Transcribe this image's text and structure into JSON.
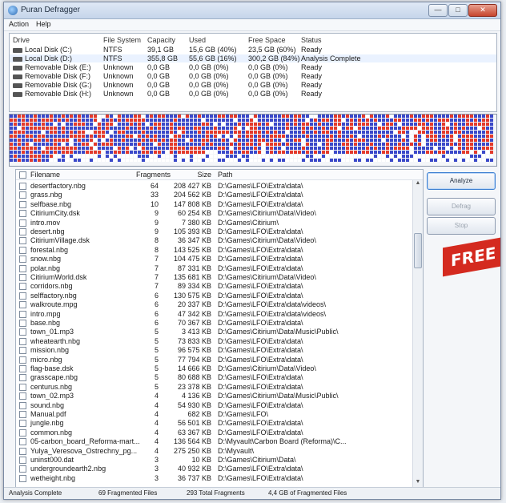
{
  "window": {
    "title": "Puran Defragger"
  },
  "menu": [
    "Action",
    "Help"
  ],
  "drives": {
    "columns": [
      "Drive",
      "File System",
      "Capacity",
      "Used",
      "Free Space",
      "Status"
    ],
    "rows": [
      {
        "drive": "Local Disk (C:)",
        "fs": "NTFS",
        "capacity": "39,1 GB",
        "used": "15,6 GB (40%)",
        "free": "23,5 GB (60%)",
        "status": "Ready"
      },
      {
        "drive": "Local Disk (D:)",
        "fs": "NTFS",
        "capacity": "355,8 GB",
        "used": "55,6 GB (16%)",
        "free": "300,2 GB (84%)",
        "status": "Analysis Complete"
      },
      {
        "drive": "Removable Disk (E:)",
        "fs": "Unknown",
        "capacity": "0,0 GB",
        "used": "0,0 GB (0%)",
        "free": "0,0 GB (0%)",
        "status": "Ready"
      },
      {
        "drive": "Removable Disk (F:)",
        "fs": "Unknown",
        "capacity": "0,0 GB",
        "used": "0,0 GB (0%)",
        "free": "0,0 GB (0%)",
        "status": "Ready"
      },
      {
        "drive": "Removable Disk (G:)",
        "fs": "Unknown",
        "capacity": "0,0 GB",
        "used": "0,0 GB (0%)",
        "free": "0,0 GB (0%)",
        "status": "Ready"
      },
      {
        "drive": "Removable Disk (H:)",
        "fs": "Unknown",
        "capacity": "0,0 GB",
        "used": "0,0 GB (0%)",
        "free": "0,0 GB (0%)",
        "status": "Ready"
      }
    ]
  },
  "files": {
    "columns": [
      "Filename",
      "Fragments",
      "Size",
      "Path"
    ],
    "rows": [
      {
        "name": "desertfactory.nbg",
        "frags": "64",
        "size": "208 427 KB",
        "path": "D:\\Games\\LFO\\Extra\\data\\"
      },
      {
        "name": "grass.nbg",
        "frags": "33",
        "size": "204 562 KB",
        "path": "D:\\Games\\LFO\\Extra\\data\\"
      },
      {
        "name": "selfbase.nbg",
        "frags": "10",
        "size": "147 808 KB",
        "path": "D:\\Games\\LFO\\Extra\\data\\"
      },
      {
        "name": "CitiriumCity.dsk",
        "frags": "9",
        "size": "60 254 KB",
        "path": "D:\\Games\\Citirium\\Data\\Video\\"
      },
      {
        "name": "intro.mov",
        "frags": "9",
        "size": "7 380 KB",
        "path": "D:\\Games\\Citirium\\"
      },
      {
        "name": "desert.nbg",
        "frags": "9",
        "size": "105 393 KB",
        "path": "D:\\Games\\LFO\\Extra\\data\\"
      },
      {
        "name": "CitiriumVillage.dsk",
        "frags": "8",
        "size": "36 347 KB",
        "path": "D:\\Games\\Citirium\\Data\\Video\\"
      },
      {
        "name": "forestal.nbg",
        "frags": "8",
        "size": "143 525 KB",
        "path": "D:\\Games\\LFO\\Extra\\data\\"
      },
      {
        "name": "snow.nbg",
        "frags": "7",
        "size": "104 475 KB",
        "path": "D:\\Games\\LFO\\Extra\\data\\"
      },
      {
        "name": "polar.nbg",
        "frags": "7",
        "size": "87 331 KB",
        "path": "D:\\Games\\LFO\\Extra\\data\\"
      },
      {
        "name": "CitiriumWorld.dsk",
        "frags": "7",
        "size": "135 681 KB",
        "path": "D:\\Games\\Citirium\\Data\\Video\\"
      },
      {
        "name": "corridors.nbg",
        "frags": "7",
        "size": "89 334 KB",
        "path": "D:\\Games\\LFO\\Extra\\data\\"
      },
      {
        "name": "selffactory.nbg",
        "frags": "6",
        "size": "130 575 KB",
        "path": "D:\\Games\\LFO\\Extra\\data\\"
      },
      {
        "name": "walkroute.mpg",
        "frags": "6",
        "size": "20 337 KB",
        "path": "D:\\Games\\LFO\\Extra\\data\\videos\\"
      },
      {
        "name": "intro.mpg",
        "frags": "6",
        "size": "47 342 KB",
        "path": "D:\\Games\\LFO\\Extra\\data\\videos\\"
      },
      {
        "name": "base.nbg",
        "frags": "6",
        "size": "70 367 KB",
        "path": "D:\\Games\\LFO\\Extra\\data\\"
      },
      {
        "name": "town_01.mp3",
        "frags": "5",
        "size": "3 413 KB",
        "path": "D:\\Games\\Citirium\\Data\\Music\\Public\\"
      },
      {
        "name": "wheatearth.nbg",
        "frags": "5",
        "size": "73 833 KB",
        "path": "D:\\Games\\LFO\\Extra\\data\\"
      },
      {
        "name": "mission.nbg",
        "frags": "5",
        "size": "96 575 KB",
        "path": "D:\\Games\\LFO\\Extra\\data\\"
      },
      {
        "name": "micro.nbg",
        "frags": "5",
        "size": "77 794 KB",
        "path": "D:\\Games\\LFO\\Extra\\data\\"
      },
      {
        "name": "flag-base.dsk",
        "frags": "5",
        "size": "14 666 KB",
        "path": "D:\\Games\\Citirium\\Data\\Video\\"
      },
      {
        "name": "grasscape.nbg",
        "frags": "5",
        "size": "80 688 KB",
        "path": "D:\\Games\\LFO\\Extra\\data\\"
      },
      {
        "name": "centurus.nbg",
        "frags": "5",
        "size": "23 378 KB",
        "path": "D:\\Games\\LFO\\Extra\\data\\"
      },
      {
        "name": "town_02.mp3",
        "frags": "4",
        "size": "4 136 KB",
        "path": "D:\\Games\\Citirium\\Data\\Music\\Public\\"
      },
      {
        "name": "sound.nbg",
        "frags": "4",
        "size": "54 930 KB",
        "path": "D:\\Games\\LFO\\Extra\\data\\"
      },
      {
        "name": "Manual.pdf",
        "frags": "4",
        "size": "682 KB",
        "path": "D:\\Games\\LFO\\"
      },
      {
        "name": "jungle.nbg",
        "frags": "4",
        "size": "56 501 KB",
        "path": "D:\\Games\\LFO\\Extra\\data\\"
      },
      {
        "name": "common.nbg",
        "frags": "4",
        "size": "63 367 KB",
        "path": "D:\\Games\\LFO\\Extra\\data\\"
      },
      {
        "name": "05-carbon_board_Reforma-mart...",
        "frags": "4",
        "size": "136 564 KB",
        "path": "D:\\Myvault\\Carbon Board (Reforma)\\C..."
      },
      {
        "name": "Yulya_Veresova_Ostrechny_pg...",
        "frags": "4",
        "size": "275 250 KB",
        "path": "D:\\Myvault\\"
      },
      {
        "name": "uninst000.dat",
        "frags": "3",
        "size": "10 KB",
        "path": "D:\\Games\\Citirium\\Data\\"
      },
      {
        "name": "undergroundearth2.nbg",
        "frags": "3",
        "size": "40 932 KB",
        "path": "D:\\Games\\LFO\\Extra\\data\\"
      },
      {
        "name": "wetheight.nbg",
        "frags": "3",
        "size": "36 737 KB",
        "path": "D:\\Games\\LFO\\Extra\\data\\"
      }
    ]
  },
  "buttons": {
    "analyze": "Analyze",
    "defrag": "Defrag",
    "stop": "Stop"
  },
  "badge": "FREE",
  "status": {
    "state": "Analysis Complete",
    "fragmented_files": "69 Fragmented Files",
    "total_fragments": "293 Total Fragments",
    "fragmented_size": "4,4 GB of Fragmented Files"
  },
  "colors": {
    "fragmented": "#e33a2c",
    "used": "#3b49c9",
    "free": "#ffffff"
  }
}
